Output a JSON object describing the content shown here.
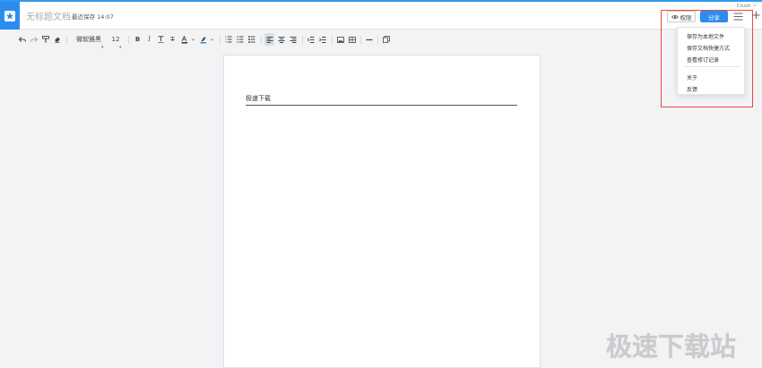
{
  "header": {
    "doc_title": "无标题文档",
    "save_status": "最近保存 14:07",
    "user_name": "Crush ~",
    "permission_label": "权限",
    "share_label": "分享",
    "accent_color": "#2d8cf0"
  },
  "toolbar": {
    "font_name": "微软雅黑",
    "font_size": "12",
    "bold": "B",
    "italic": "I",
    "strikethrough": "T"
  },
  "document": {
    "text": "极速下载"
  },
  "menu": {
    "items": [
      "保存为本地文件",
      "保存文档快捷方式",
      "查看修订记录",
      "关于",
      "反馈"
    ]
  },
  "watermark": "极速下载站"
}
